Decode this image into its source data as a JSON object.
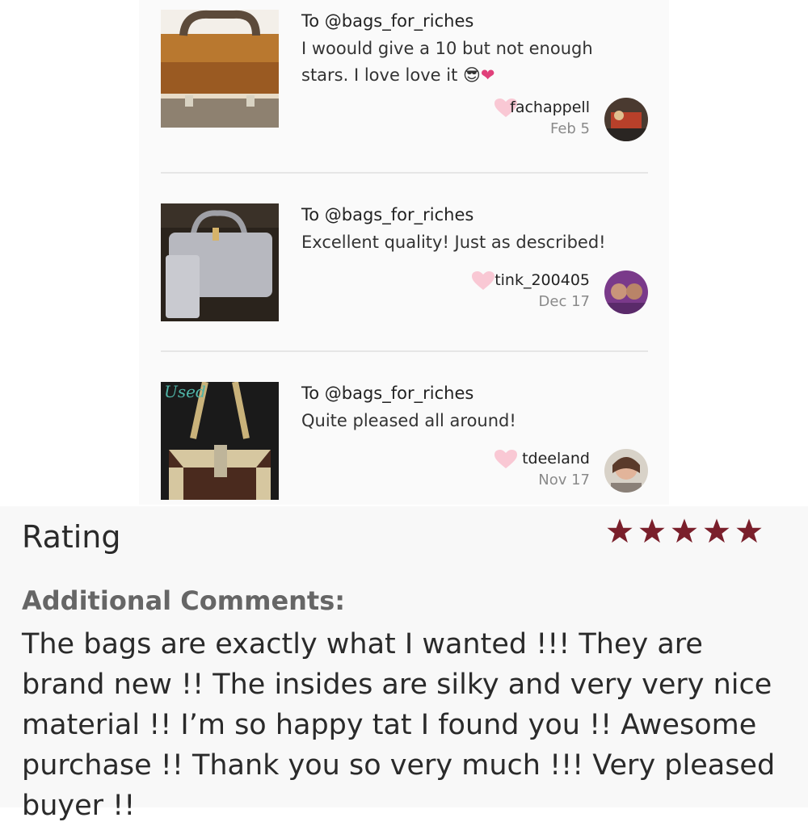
{
  "reviews": [
    {
      "to": "To @bags_for_riches",
      "comment": "I woould give a 10 but not enough stars. I love love it",
      "comment_emoji": "😎",
      "comment_emoji2": "❤",
      "username": "fachappell",
      "date": "Feb 5"
    },
    {
      "to": "To @bags_for_riches",
      "comment": "Excellent quality! Just as described!",
      "username": "tink_200405",
      "date": "Dec 17"
    },
    {
      "to": "To @bags_for_riches",
      "comment": "Quite pleased all around!",
      "thumb_overlay": "Used",
      "username": "tdeeland",
      "date": "Nov 17"
    }
  ],
  "rating": {
    "label": "Rating",
    "stars": 5,
    "star_color": "#7a1f2b"
  },
  "additional": {
    "title": "Additional Comments:",
    "body": "The bags are exactly what I wanted !!! They are brand new !! The insides are silky and very very nice material !! I’m so happy tat I found you !! Awesome purchase !! Thank you so very much !!! Very pleased buyer !!"
  },
  "colors": {
    "heart": "#f9c8d4",
    "divider": "#e6e6e6",
    "date": "#8a8a8a"
  }
}
